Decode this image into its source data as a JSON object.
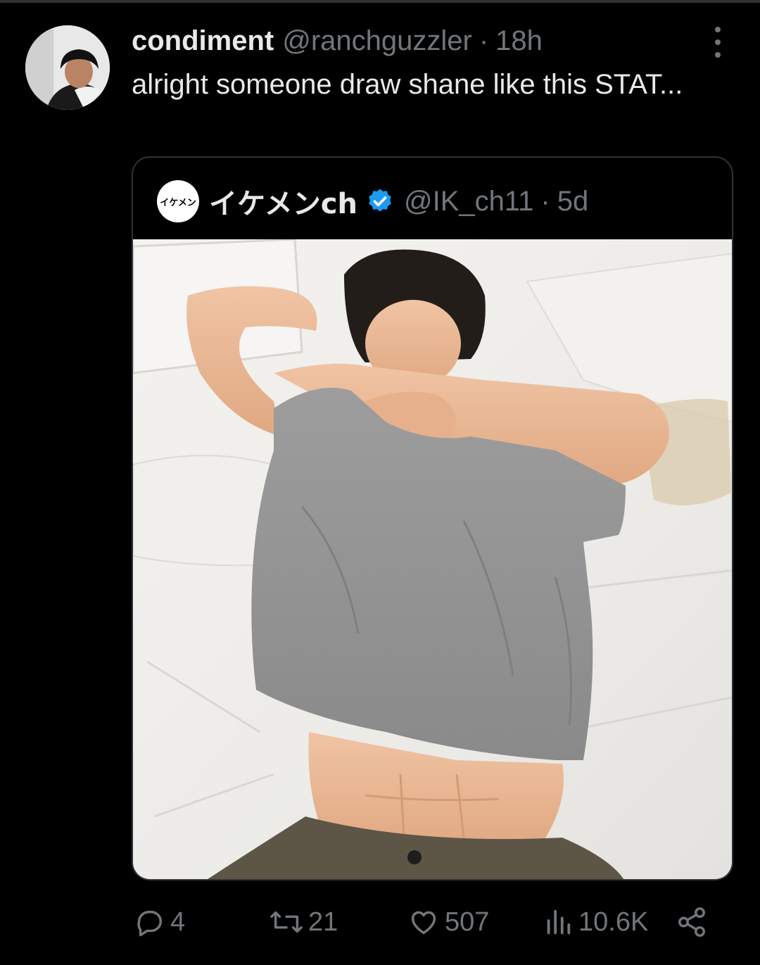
{
  "tweet": {
    "display_name": "condiment",
    "handle": "@ranchguzzler",
    "separator": "·",
    "time": "18h",
    "text": "alright someone draw shane like this STAT..."
  },
  "quoted_tweet": {
    "avatar_text": "イケメン",
    "display_name": "イケメンch",
    "handle": "@IK_ch11",
    "separator": "·",
    "time": "5d",
    "media_description_icon": "photo"
  },
  "actions": {
    "replies": "4",
    "retweets": "21",
    "likes": "507",
    "views": "10.6K"
  },
  "icons": [
    "more-options-icon",
    "verified-badge-icon",
    "reply-icon",
    "retweet-icon",
    "like-icon",
    "views-icon",
    "share-icon"
  ],
  "colors": {
    "background": "#000000",
    "text_primary": "#e7e9ea",
    "text_secondary": "#71767b",
    "border": "#2f3336",
    "verified": "#1d9bf0"
  }
}
